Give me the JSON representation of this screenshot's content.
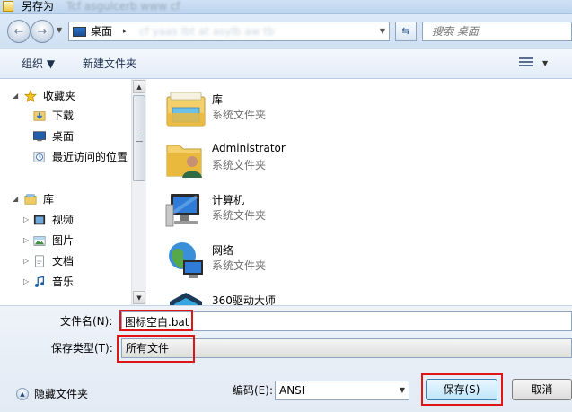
{
  "window": {
    "title": "另存为",
    "title_extra": "Tcf asgulcerb  www  cf"
  },
  "address": {
    "location": "桌面",
    "separator": "▸",
    "ghost_path": "cf  yaas  lbt at  asylb  aw  tb"
  },
  "search": {
    "placeholder": "搜索 桌面"
  },
  "toolbar": {
    "organize_label": "组织 ▼",
    "new_folder_label": "新建文件夹"
  },
  "nav": {
    "favorites_label": "收藏夹",
    "downloads_label": "下载",
    "desktop_label": "桌面",
    "recent_label": "最近访问的位置",
    "libraries_label": "库",
    "videos_label": "视频",
    "pictures_label": "图片",
    "documents_label": "文档",
    "music_label": "音乐"
  },
  "files": [
    {
      "name": "库",
      "type": "系统文件夹",
      "icon": "library-icon"
    },
    {
      "name": "Administrator",
      "type": "系统文件夹",
      "icon": "user-folder-icon"
    },
    {
      "name": "计算机",
      "type": "系统文件夹",
      "icon": "computer-icon"
    },
    {
      "name": "网络",
      "type": "系统文件夹",
      "icon": "network-icon"
    },
    {
      "name": "360驱动大师",
      "type": "",
      "icon": "app-icon"
    }
  ],
  "form": {
    "filename_label": "文件名(N):",
    "filename_value": "图标空白.bat",
    "filetype_label": "保存类型(T):",
    "filetype_value": "所有文件",
    "hide_folders_label": "隐藏文件夹",
    "encoding_label": "编码(E):",
    "encoding_value": "ANSI",
    "save_label": "保存(S)",
    "cancel_label": "取消"
  },
  "colors": {
    "highlight_box": "#e01515",
    "accent": "#3c7fb1"
  }
}
